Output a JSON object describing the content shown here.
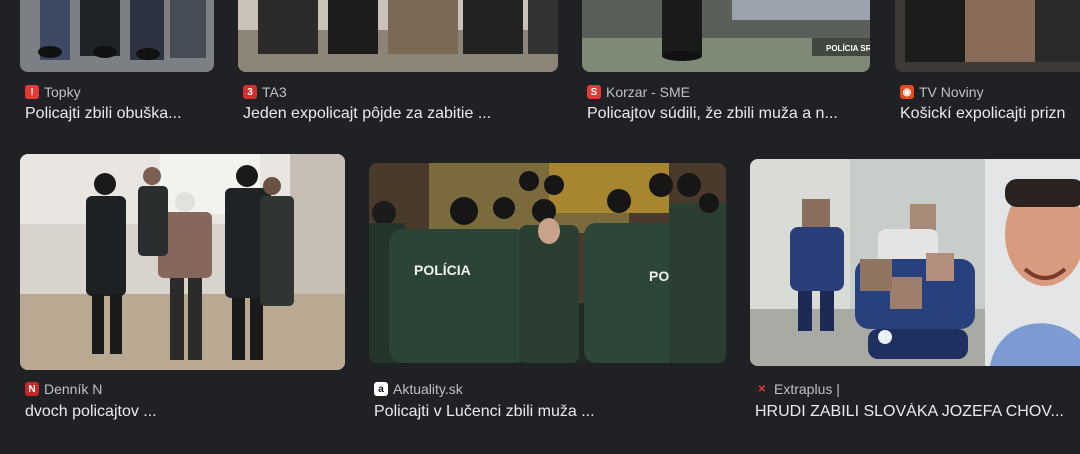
{
  "results": [
    {
      "source": "Topky",
      "title": "Policajti zbili obuška...",
      "favicon_color": "#e53935",
      "favicon_glyph": "!",
      "favicon_text_color": "#ffffff"
    },
    {
      "source": "TA3",
      "title": "Jeden expolicajt pôjde za zabitie ...",
      "favicon_color": "#d32f2f",
      "favicon_glyph": "3",
      "favicon_text_color": "#ffffff"
    },
    {
      "source": "Korzar - SME",
      "title": "Policajtov súdili, že zbili muža a n...",
      "favicon_color": "#e53935",
      "favicon_glyph": "S",
      "favicon_text_color": "#ffffff",
      "image_caption": "POLÍCIA SR"
    },
    {
      "source": "TV Noviny",
      "title": "Košickí expolicajti prizn",
      "favicon_color": "#e64a19",
      "favicon_glyph": "◉",
      "favicon_text_color": "#ffffff"
    },
    {
      "source": "Denník N",
      "title": "dvoch policajtov ...",
      "favicon_color": "#c62828",
      "favicon_glyph": "N",
      "favicon_text_color": "#ffffff"
    },
    {
      "source": "Aktuality.sk",
      "title": "Policajti v Lučenci zbili muža ...",
      "favicon_color": "#ffffff",
      "favicon_glyph": "a",
      "favicon_text_color": "#111111",
      "image_labels": [
        "POLÍCIA",
        "POLÍCIA"
      ]
    },
    {
      "source": "Extraplus |",
      "title": "HRUDI ZABILI SLOVÁKA JOZEFA CHOV...",
      "favicon_color": "#202124",
      "favicon_glyph": "✕",
      "favicon_text_color": "#e53935"
    }
  ]
}
